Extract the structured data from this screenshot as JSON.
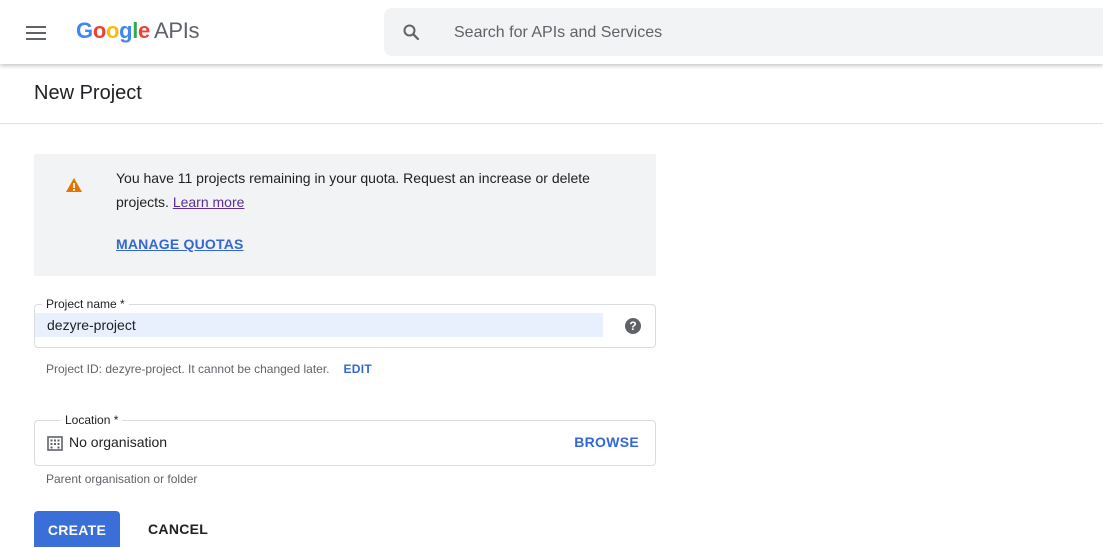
{
  "header": {
    "menu_icon": "hamburger-menu-icon",
    "logo": {
      "word_parts": [
        "G",
        "o",
        "o",
        "g",
        "l",
        "e"
      ],
      "word_colors": [
        "#4285f4",
        "#ea4335",
        "#fbbc05",
        "#4285f4",
        "#34a853",
        "#ea4335"
      ],
      "suffix": "APIs"
    },
    "search": {
      "icon": "search-icon",
      "placeholder": "Search for APIs and Services",
      "value": ""
    }
  },
  "page": {
    "title": "New Project"
  },
  "quota_notice": {
    "icon": "warning-icon",
    "icon_color": "#e37400",
    "text": "You have 11 projects remaining in your quota. Request an increase or delete projects.",
    "link_label": "Learn more",
    "action_label": "MANAGE QUOTAS"
  },
  "form": {
    "project_name": {
      "label": "Project name *",
      "value": "dezyre-project",
      "help_icon": "help-circle-icon"
    },
    "project_id": {
      "text": "Project ID: dezyre-project. It cannot be changed later.",
      "edit_label": "EDIT"
    },
    "location": {
      "label": "Location *",
      "icon": "building-icon",
      "value": "No organisation",
      "browse_label": "BROWSE",
      "hint": "Parent organisation or folder"
    }
  },
  "actions": {
    "create_label": "CREATE",
    "cancel_label": "CANCEL"
  },
  "colors": {
    "accent": "#3367d6",
    "primary_button": "#3b6fd8",
    "notice_background": "#f1f3f4",
    "input_highlight": "#e8f0fe"
  }
}
